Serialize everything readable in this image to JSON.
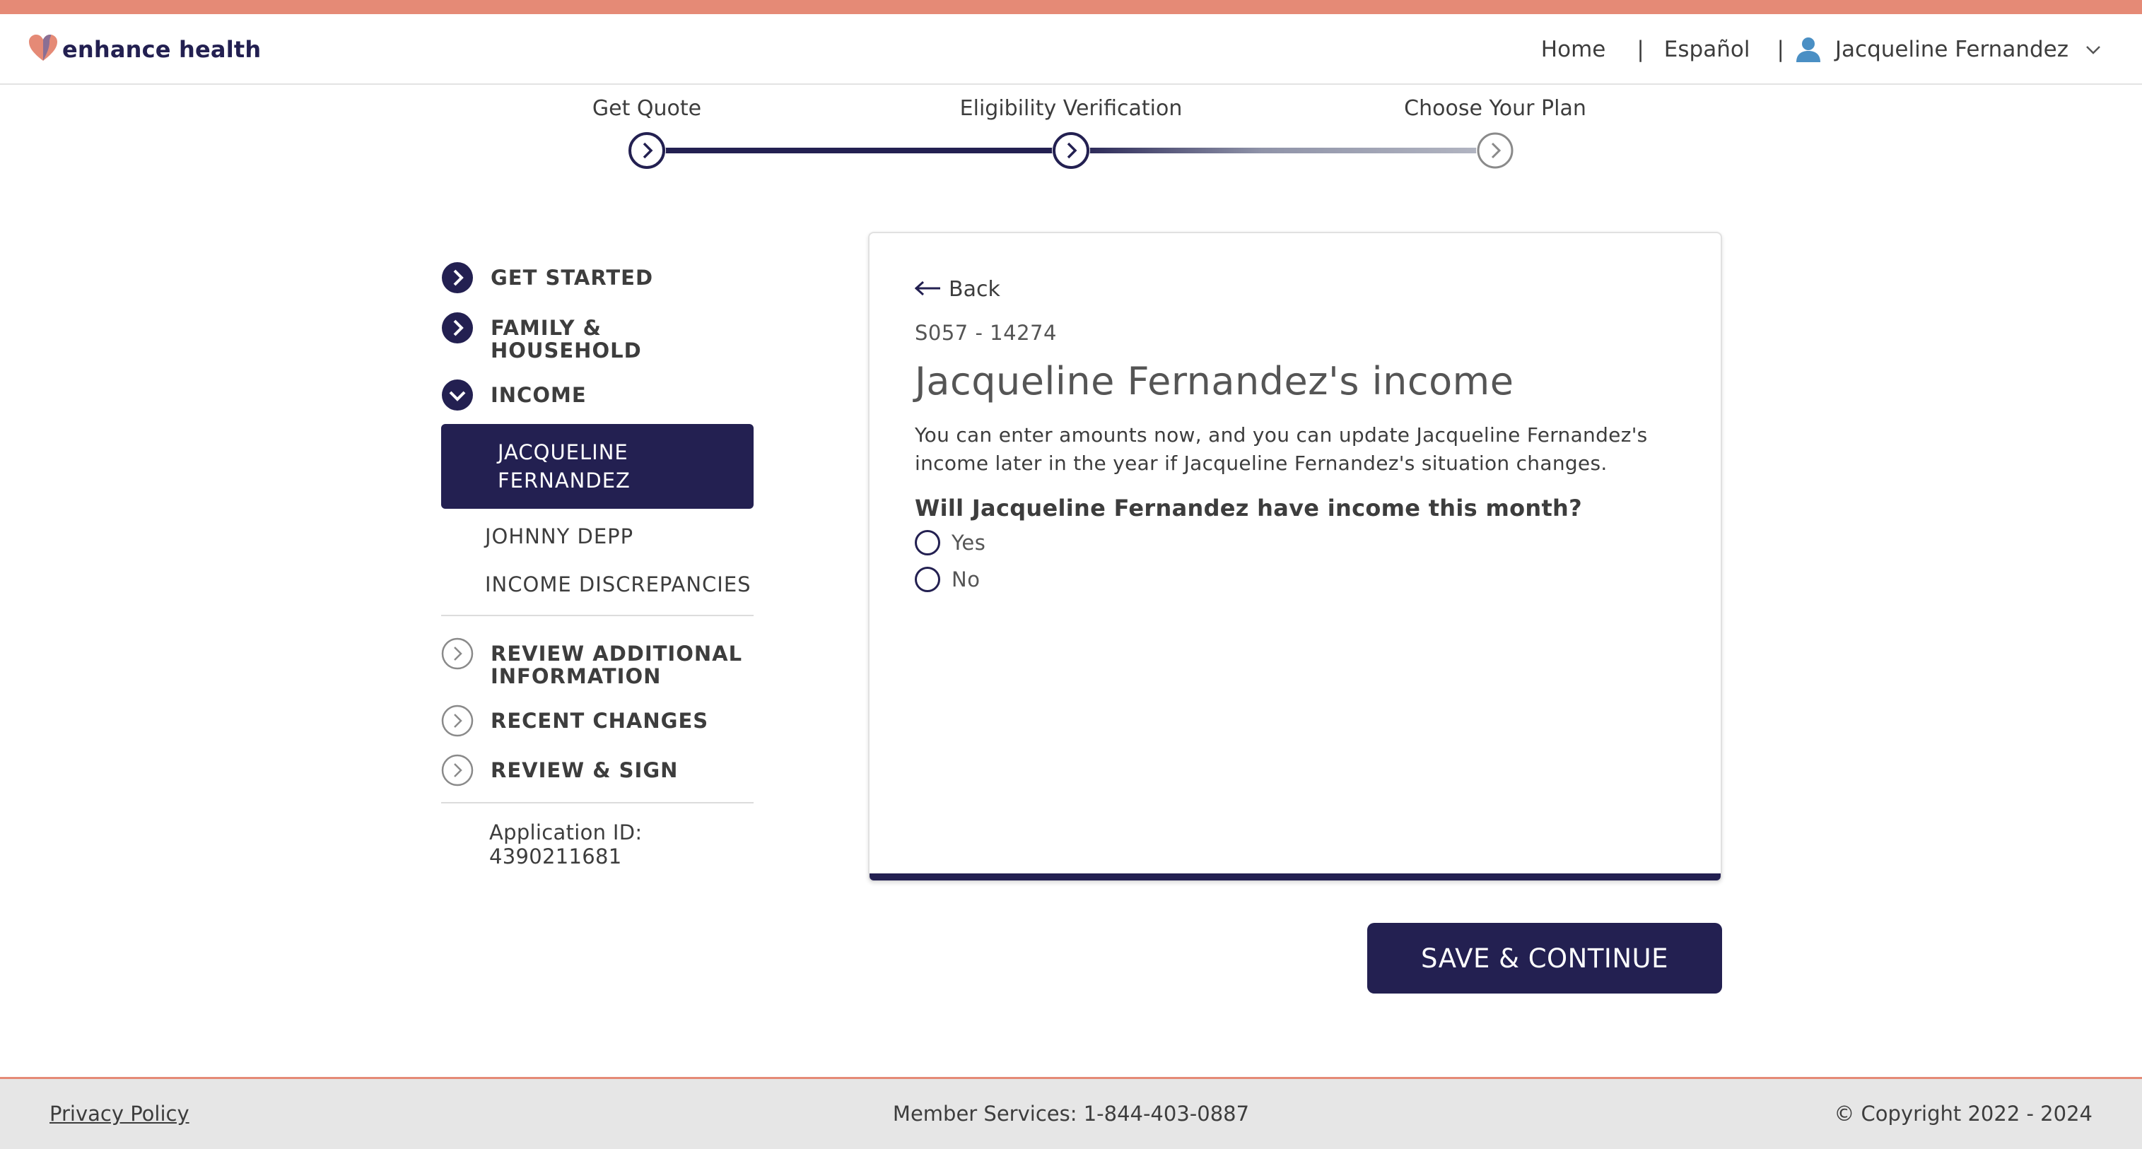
{
  "header": {
    "logo_text": "enhance health",
    "nav": {
      "home": "Home",
      "separator": "|",
      "language": "Español",
      "user_name": "Jacqueline Fernandez"
    }
  },
  "stepper": {
    "steps": [
      {
        "label": "Get Quote",
        "state": "complete"
      },
      {
        "label": "Eligibility Verification",
        "state": "current"
      },
      {
        "label": "Choose Your Plan",
        "state": "upcoming"
      }
    ]
  },
  "sidebar": {
    "sections": [
      {
        "label": "GET STARTED",
        "state": "complete"
      },
      {
        "label": "FAMILY & HOUSEHOLD",
        "state": "complete"
      },
      {
        "label": "INCOME",
        "state": "expanded"
      },
      {
        "label": "REVIEW ADDITIONAL INFORMATION",
        "state": "upcoming"
      },
      {
        "label": "RECENT CHANGES",
        "state": "upcoming"
      },
      {
        "label": "REVIEW & SIGN",
        "state": "upcoming"
      }
    ],
    "income_subitems": [
      {
        "label": "JACQUELINE FERNANDEZ",
        "active": true
      },
      {
        "label": "JOHNNY DEPP",
        "active": false
      },
      {
        "label": "INCOME DISCREPANCIES",
        "active": false
      }
    ],
    "application_id": "Application ID: 4390211681"
  },
  "main": {
    "back_label": "Back",
    "case_id": "S057 - 14274",
    "title": "Jacqueline Fernandez's income",
    "description": "You can enter amounts now, and you can update Jacqueline Fernandez's income later in the year if Jacqueline Fernandez's situation changes.",
    "question": "Will Jacqueline Fernandez have income this month?",
    "options": [
      "Yes",
      "No"
    ],
    "selected_option": null,
    "save_button": "SAVE & CONTINUE"
  },
  "footer": {
    "privacy": "Privacy Policy",
    "member_services": "Member Services: 1-844-403-0887",
    "copyright": "© Copyright 2022 - 2024"
  },
  "colors": {
    "brand_navy": "#232051",
    "accent_coral": "#e58a76",
    "inactive_gray": "#8a8a8a"
  },
  "icons": [
    "heart-logo-icon",
    "user-icon",
    "chevron-down-icon",
    "arrow-left-icon",
    "chevron-right-circle-icon",
    "chevron-down-circle-icon"
  ]
}
